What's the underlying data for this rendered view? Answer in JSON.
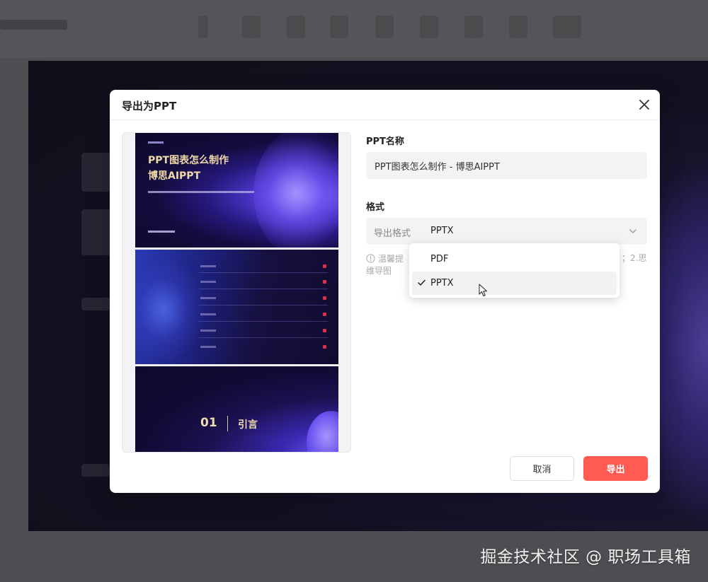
{
  "modal": {
    "title": "导出为PPT",
    "name_label": "PPT名称",
    "name_value": "PPT图表怎么制作 - 博思AIPPT",
    "format_label": "格式",
    "format_field_label": "导出格式",
    "format_selected": "PPTX",
    "tip_text": "温馨提",
    "tip_text_line2": "维导图",
    "tip_text_end": "；2.思",
    "cancel_label": "取消",
    "export_label": "导出"
  },
  "dropdown": {
    "options": [
      "PDF",
      "PPTX"
    ],
    "selected_index": 1
  },
  "preview": {
    "slide1_title_line1": "PPT图表怎么制作",
    "slide1_title_line2": "博思AIPPT",
    "slide3_number": "01",
    "slide3_label": "引言"
  },
  "watermark": "掘金技术社区 @ 职场工具箱",
  "colors": {
    "accent": "#ff5b52",
    "slide_gold": "#f0d9a8"
  },
  "icons": {
    "close": "close-icon",
    "chevron": "chevron-down-icon",
    "check": "check-icon",
    "info": "info-icon",
    "cursor": "cursor-icon"
  }
}
